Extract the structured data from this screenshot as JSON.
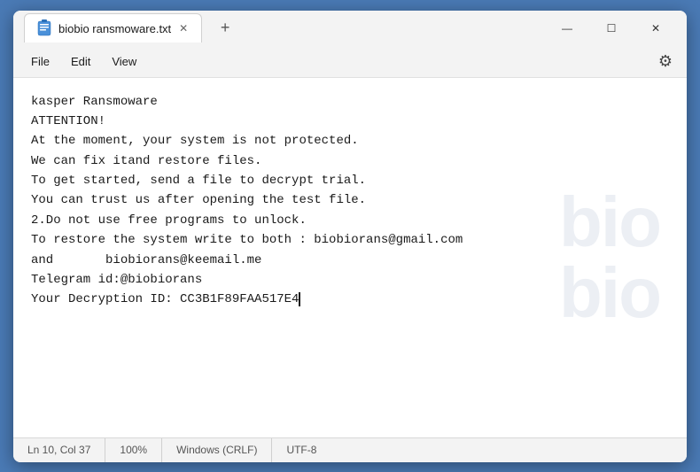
{
  "window": {
    "title": "biobio ransmoware.txt",
    "controls": {
      "minimize": "—",
      "maximize": "☐",
      "close": "✕"
    },
    "new_tab_label": "+"
  },
  "menu": {
    "items": [
      "File",
      "Edit",
      "View"
    ],
    "settings_label": "⚙"
  },
  "editor": {
    "content_lines": [
      "kasper Ransmoware",
      "ATTENTION!",
      "At the moment, your system is not protected.",
      "We can fix itand restore files.",
      "To get started, send a file to decrypt trial.",
      "You can trust us after opening the test file.",
      "2.Do not use free programs to unlock.",
      "To restore the system write to both : biobiorans@gmail.com",
      "and       biobiorans@keemail.me",
      "Telegram id:@biobiorans",
      "Your Decryption ID: CC3B1F89FAA517E4"
    ],
    "watermark_line1": "bio",
    "watermark_line2": "bio"
  },
  "status_bar": {
    "position": "Ln 10, Col 37",
    "zoom": "100%",
    "line_ending": "Windows (CRLF)",
    "encoding": "UTF-8"
  }
}
